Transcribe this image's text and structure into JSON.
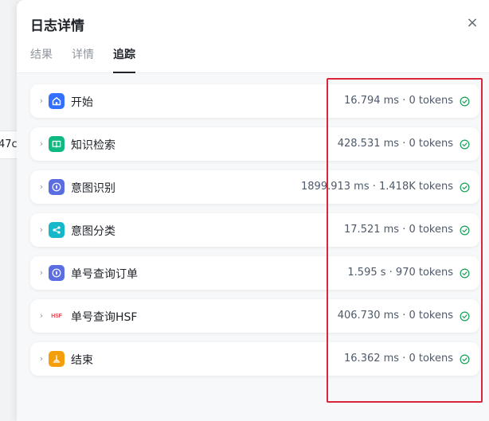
{
  "background": {
    "fragment_text": "47c"
  },
  "modal": {
    "title": "日志详情",
    "close_label": "×",
    "tabs": [
      {
        "label": "结果"
      },
      {
        "label": "详情"
      },
      {
        "label": "追踪",
        "active": true
      }
    ]
  },
  "trace": {
    "rows": [
      {
        "name": "开始",
        "metric": "16.794 ms · 0 tokens",
        "icon": "home-icon",
        "icon_color": "#3370ff",
        "status": "success"
      },
      {
        "name": "知识检索",
        "metric": "428.531 ms · 0 tokens",
        "icon": "book-icon",
        "icon_color": "#10b981",
        "status": "success"
      },
      {
        "name": "意图识别",
        "metric": "1899.913 ms · 1.418K tokens",
        "icon": "compass-icon",
        "icon_color": "#5b6ee1",
        "status": "success"
      },
      {
        "name": "意图分类",
        "metric": "17.521 ms · 0 tokens",
        "icon": "share-icon",
        "icon_color": "#14b8c8",
        "status": "success"
      },
      {
        "name": "单号查询订单",
        "metric": "1.595 s · 970 tokens",
        "icon": "compass-icon",
        "icon_color": "#5b6ee1",
        "status": "success"
      },
      {
        "name": "单号查询HSF",
        "metric": "406.730 ms · 0 tokens",
        "icon": "hsf-icon",
        "icon_text": "HSF",
        "icon_color": "#e5484d",
        "status": "success"
      },
      {
        "name": "结束",
        "metric": "16.362 ms · 0 tokens",
        "icon": "flag-icon",
        "icon_color": "#f59e0b",
        "status": "success"
      }
    ]
  },
  "colors": {
    "success": "#18a058",
    "highlight": "#d9263a"
  }
}
